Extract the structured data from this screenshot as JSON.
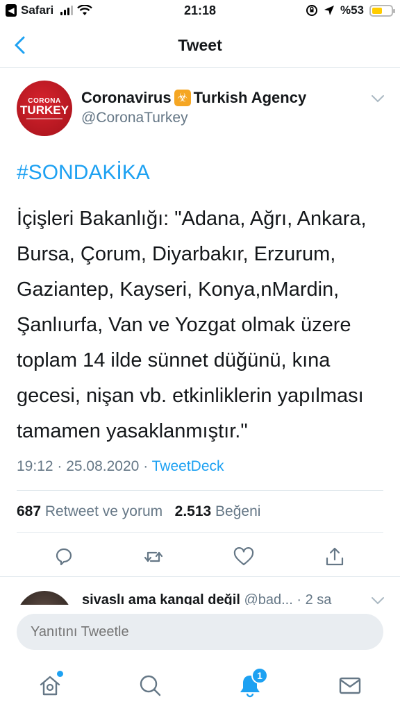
{
  "status_bar": {
    "back_app_label": "Safari",
    "time": "21:18",
    "battery_text": "%53",
    "battery_level": 0.53
  },
  "nav": {
    "title": "Tweet"
  },
  "tweet": {
    "author": {
      "name": "Coronavirus",
      "name_suffix": "Turkish Agency",
      "badge_icon": "biohazard-icon",
      "handle": "@CoronaTurkey",
      "avatar_top": "CORONA",
      "avatar_main": "TURKEY"
    },
    "hashtag": "#SONDAKİKA",
    "text_lines": [
      "İçişleri Bakanlığı: \"Adana, Ağrı, Ankara,",
      "Bursa, Çorum, Diyarbakır, Erzurum,",
      "Gaziantep, Kayseri, Konya,nMardin,",
      "Şanlıurfa, Van ve Yozgat olmak üzere",
      "toplam 14 ilde sünnet düğünü, kına",
      "gecesi, nişan vb. etkinliklerin yapılması",
      "tamamen yasaklanmıştır.\""
    ],
    "time": "19:12",
    "date": "25.08.2020",
    "source": "TweetDeck",
    "stats": {
      "retweets": "687",
      "retweets_label": "Retweet ve yorum",
      "likes": "2.513",
      "likes_label": "Beğeni"
    }
  },
  "reply_preview": {
    "name": "sivaslı ama kangal değil",
    "handle": "@bad...",
    "time": "2 sa"
  },
  "composer": {
    "placeholder": "Yanıtını Tweetle"
  },
  "tabbar": {
    "notifications_badge": "1"
  },
  "colors": {
    "accent": "#1da1f2",
    "muted": "#657786",
    "divider": "#e1e8ed"
  }
}
